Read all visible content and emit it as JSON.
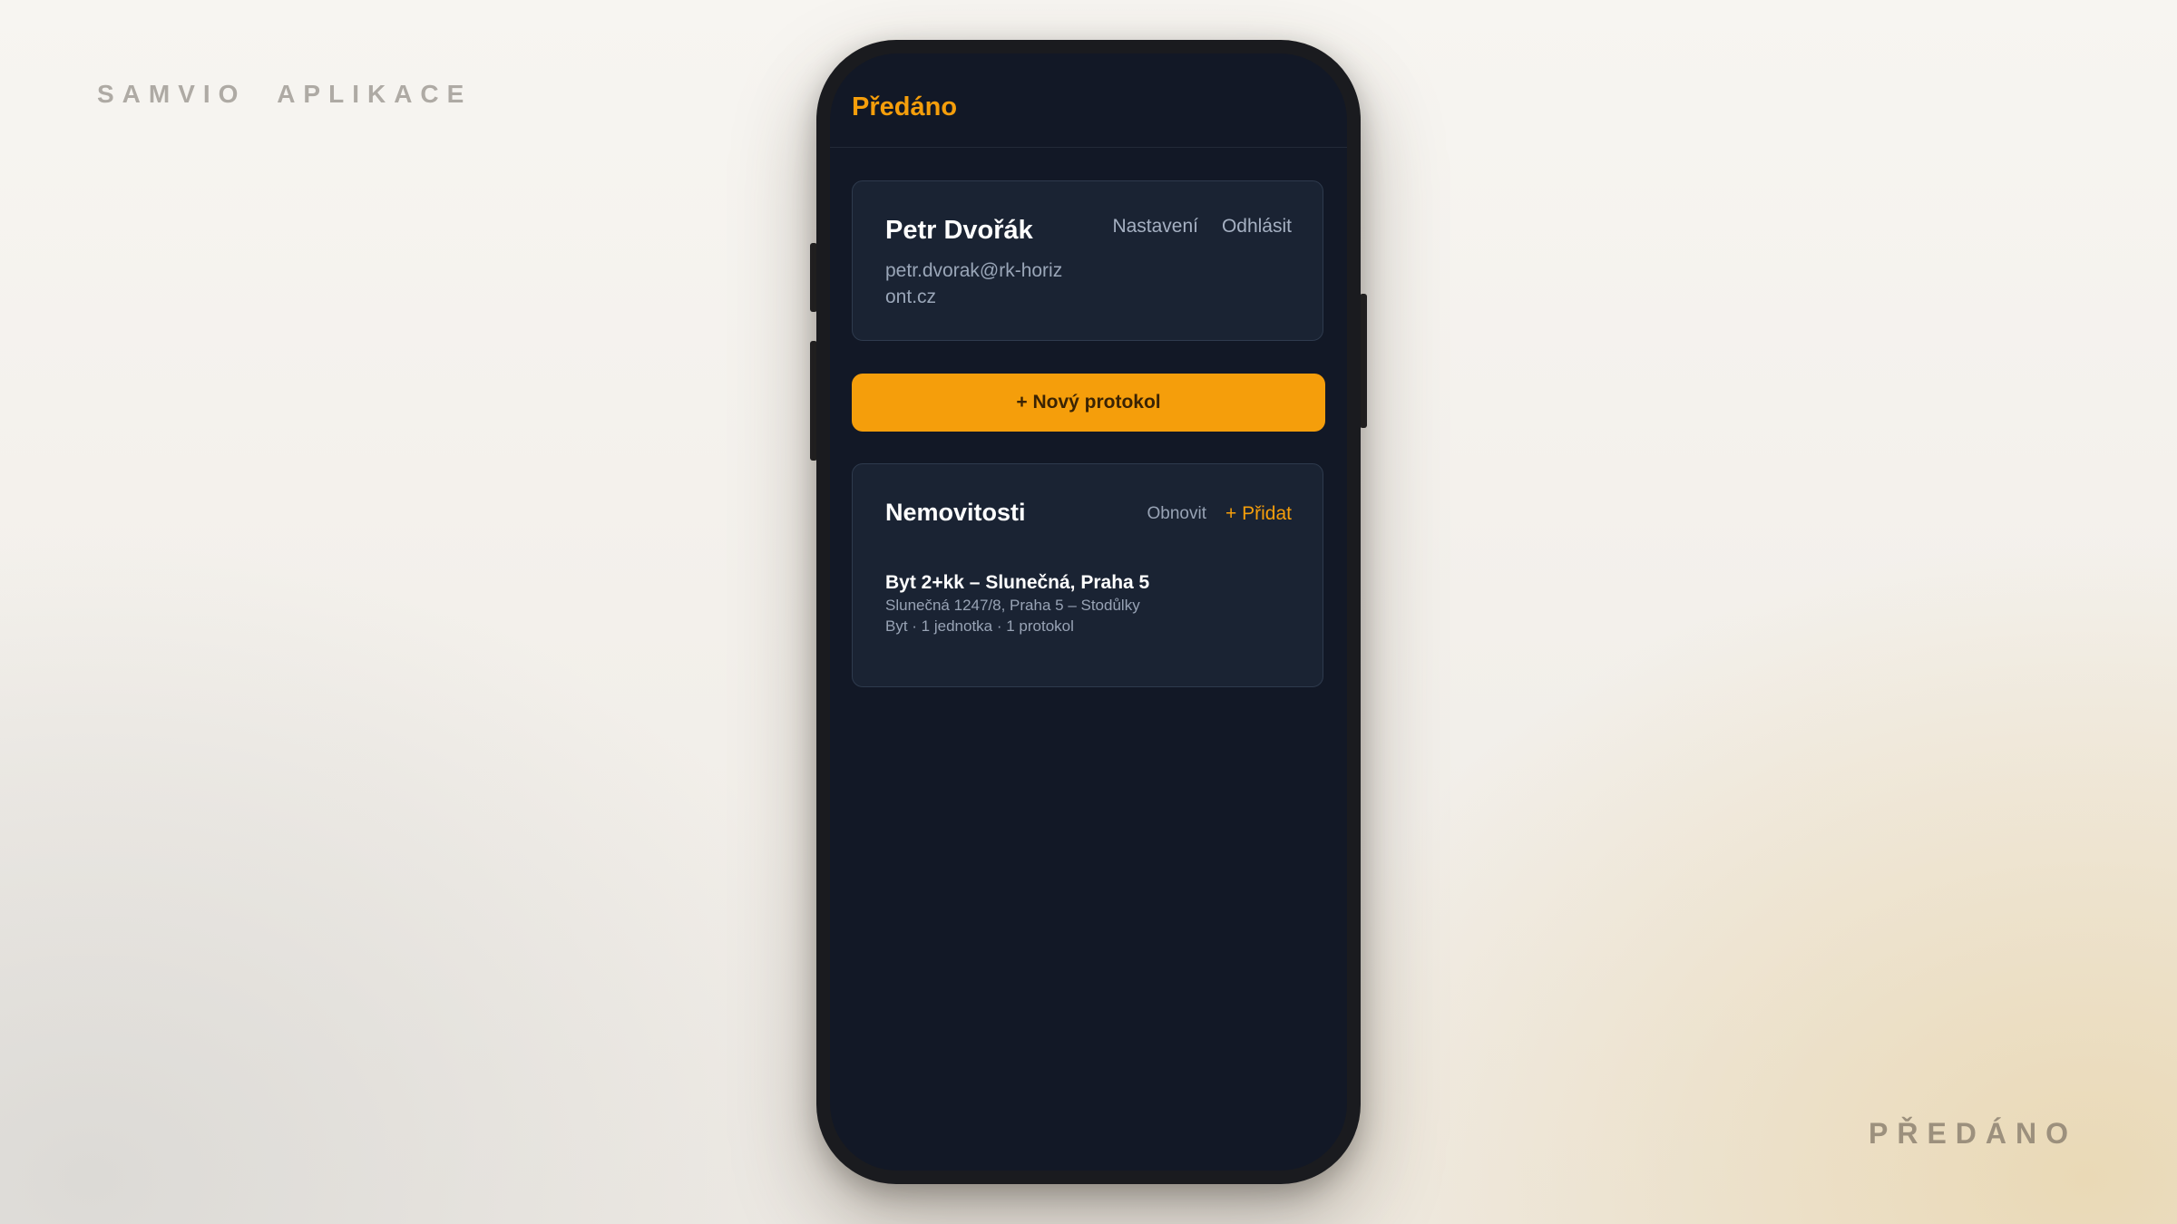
{
  "branding": {
    "top_label": "SAMVIO APLIKACE",
    "bottom_label": "PŘEDÁNO"
  },
  "app": {
    "title": "Předáno"
  },
  "user": {
    "name": "Petr Dvořák",
    "email": "petr.dvorak@rk-horizont.cz",
    "settings_label": "Nastavení",
    "logout_label": "Odhlásit"
  },
  "actions": {
    "new_protocol_label": "+ Nový protokol"
  },
  "properties": {
    "title": "Nemovitosti",
    "refresh_label": "Obnovit",
    "add_label": "+ Přidat",
    "items": [
      {
        "name": "Byt 2+kk – Slunečná, Praha 5",
        "address": "Slunečná 1247/8, Praha 5 – Stodůlky",
        "meta": "Byt · 1 jednotka · 1 protokol"
      }
    ]
  },
  "colors": {
    "accent": "#f59e0b",
    "screen_bg": "#121826",
    "card_bg": "#1a2333"
  }
}
